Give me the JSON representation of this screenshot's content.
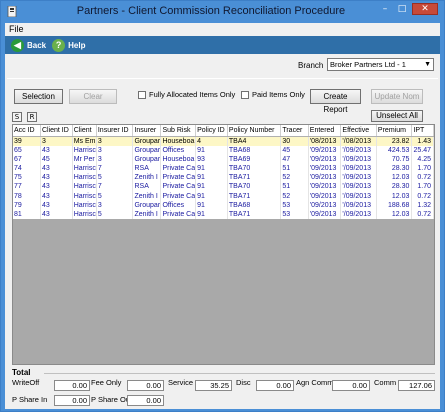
{
  "window": {
    "title": "Partners - Client Commission Reconciliation Procedure",
    "close_glyph": "✕"
  },
  "menu": {
    "file": "File"
  },
  "toolbar": {
    "back": "Back",
    "help": "Help"
  },
  "branch": {
    "label": "Branch",
    "value": "Broker Partners Ltd - 1"
  },
  "actions": {
    "selection": "Selection",
    "clear": "Clear",
    "fully_allocated": "Fully Allocated Items Only",
    "paid_items": "Paid Items Only",
    "create_report": "Create Report",
    "update_nom": "Update Nom",
    "s": "S",
    "r": "R",
    "unselect_all": "Unselect All"
  },
  "table": {
    "columns": [
      "Acc ID",
      "Client ID",
      "Client",
      "Insurer ID",
      "Insurer",
      "Sub Risk",
      "Policy ID",
      "Policy Number",
      "Tracer",
      "Entered",
      "Effective",
      "Premium",
      "IPT"
    ],
    "rows": [
      [
        "39",
        "3",
        "Ms Em",
        "3",
        "Groupar",
        "Houseboa",
        "4",
        "TBA4",
        "30",
        "'08/2013",
        "'/08/2013",
        "23.82",
        "1.43"
      ],
      [
        "65",
        "43",
        "Harrisc",
        "3",
        "Groupar",
        "Offices",
        "91",
        "TBA68",
        "45",
        "'09/2013",
        "'/09/2013",
        "424.53",
        "25.47"
      ],
      [
        "67",
        "45",
        "Mr Per",
        "3",
        "Groupar",
        "Houseboa",
        "93",
        "TBA69",
        "47",
        "'09/2013",
        "'/09/2013",
        "70.75",
        "4.25"
      ],
      [
        "74",
        "43",
        "Harrisc",
        "7",
        "RSA",
        "Private Ca",
        "91",
        "TBA70",
        "51",
        "'09/2013",
        "'/09/2013",
        "28.30",
        "1.70"
      ],
      [
        "75",
        "43",
        "Harrisc",
        "5",
        "Zenith I",
        "Private Ca",
        "91",
        "TBA71",
        "52",
        "'09/2013",
        "'/09/2013",
        "12.03",
        "0.72"
      ],
      [
        "77",
        "43",
        "Harrisc",
        "7",
        "RSA",
        "Private Ca",
        "91",
        "TBA70",
        "51",
        "'09/2013",
        "'/09/2013",
        "28.30",
        "1.70"
      ],
      [
        "78",
        "43",
        "Harrisc",
        "5",
        "Zenith I",
        "Private Ca",
        "91",
        "TBA71",
        "52",
        "'09/2013",
        "'/09/2013",
        "12.03",
        "0.72"
      ],
      [
        "79",
        "43",
        "Harrisc",
        "3",
        "Groupar",
        "Offices",
        "91",
        "TBA68",
        "53",
        "'09/2013",
        "'/09/2013",
        "188.68",
        "1.32"
      ],
      [
        "81",
        "43",
        "Harrisc",
        "5",
        "Zenith I",
        "Private Ca",
        "91",
        "TBA71",
        "53",
        "'09/2013",
        "'/09/2013",
        "12.03",
        "0.72"
      ]
    ]
  },
  "totals": {
    "legend": "Total",
    "write_off_label": "WriteOff",
    "write_off": "0.00",
    "fee_only_label": "Fee Only",
    "fee_only": "0.00",
    "service_label": "Service",
    "service": "35.25",
    "disc_label": "Disc",
    "disc": "0.00",
    "agn_comm_label": "Agn Comm",
    "agn_comm": "0.00",
    "comm_label": "Comm",
    "comm": "127.06",
    "p_share_in_label": "P Share In",
    "p_share_in": "0.00",
    "p_share_out_label": "P Share Out",
    "p_share_out": "0.00"
  }
}
